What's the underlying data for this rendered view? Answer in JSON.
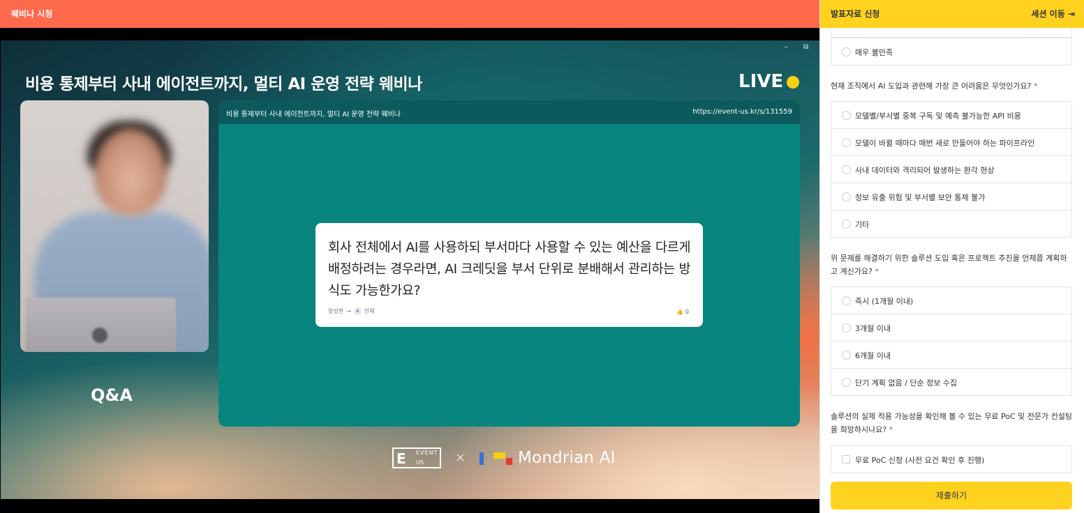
{
  "topbar": {
    "title": "웨비나 시청"
  },
  "stage": {
    "title": "비용 통제부터 사내 에이전트까지, 멀티 AI 운영 전략 웨비나",
    "live_label": "LIVE",
    "min_icon": "–",
    "max_icon": "⧉",
    "qa_label": "Q&A"
  },
  "panel": {
    "title": "비용 통제부터 사내 에이전트까지, 멀티 AI 운영 전략 웨비나",
    "url": "https://event-us.kr/s/131559"
  },
  "question": {
    "text": "회사 전체에서 AI를 사용하되 부서마다 사용할 수 있는 예산을 다르게 배정하려는 경우라면, AI 크레딧을 부서 단위로 분배해서 관리하는 방식도 가능한가요?",
    "author": "양성현",
    "arrow": "→",
    "target_avatar": "A",
    "target": "전체",
    "like_icon": "👍",
    "likes": "0"
  },
  "brand": {
    "eventus_e": "E",
    "eventus_top": "EVENT",
    "eventus_bottom": "US",
    "times": "×",
    "partner": "Mondrian AI",
    "colors": {
      "blue": "#3a6fd8",
      "yellow": "#f6d20e",
      "red": "#e53b2f"
    }
  },
  "sidebar": {
    "header_left": "발표자료 신청",
    "header_right": "세션 이동 ⇥",
    "prev_option": "매우 불만족",
    "q1": {
      "text": "현재 조직에서 AI 도입과 관련해 가장 큰 어려움은 무엇인가요?",
      "req": "*",
      "options": [
        "모델별/부서별 중복 구독 및 예측 불가능한 API 비용",
        "모델이 바뀔 때마다 매번 새로 만들어야 하는 파이프라인",
        "사내 데이터와 격리되어 발생하는 환각 현상",
        "정보 유출 위험 및 부서별 보안 통제 불가",
        "기타"
      ]
    },
    "q2": {
      "text": "위 문제를 해결하기 위한 솔루션 도입 혹은 프로젝트 추진을 언제쯤 계획하고 계신가요?",
      "req": "*",
      "options": [
        "즉시 (1개월 이내)",
        "3개월 이내",
        "6개월 이내",
        "단기 계획 없음 / 단순 정보 수집"
      ]
    },
    "q3": {
      "text": "솔루션의 실제 적용 가능성을 확인해 볼 수 있는 무료 PoC 및 전문가 컨설팅을 희망하시나요?",
      "req": "*",
      "options": [
        "무료 PoC 신청 (사전 요건 확인 후 진행)"
      ]
    },
    "submit": "제출하기"
  },
  "colors": {
    "topbar": "#ff6a4c",
    "accent_yellow": "#ffd21f",
    "panel_teal": "#09857f"
  }
}
